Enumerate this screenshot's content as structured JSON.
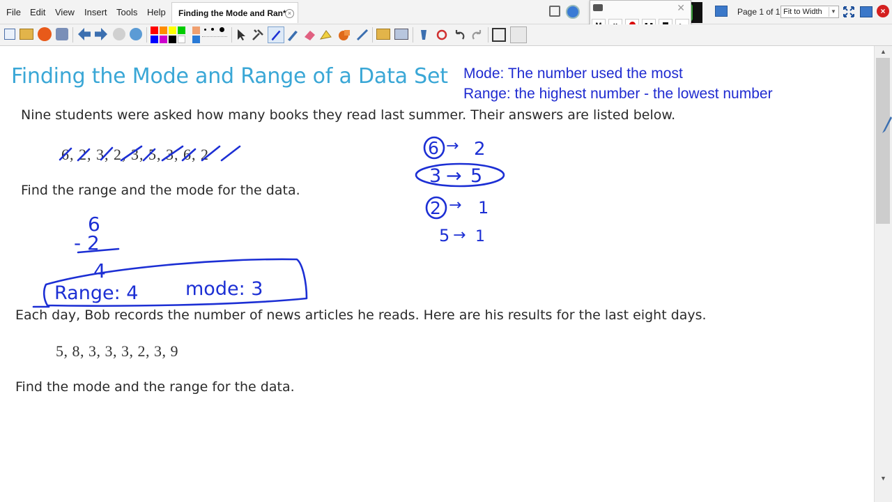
{
  "menu": {
    "items": [
      "File",
      "Edit",
      "View",
      "Insert",
      "Tools",
      "Help"
    ]
  },
  "tab": {
    "title": "Finding the Mode and Ran*",
    "close_glyph": "×"
  },
  "recorder": {
    "m_label": "M",
    "x_label": "×",
    "close_glyph": "✕"
  },
  "page_indicator": "Page 1 of 1",
  "zoom": {
    "selected": "Fit to Width"
  },
  "colors": {
    "accent_title": "#3aa7d6",
    "definition_text": "#1f2bd0",
    "ink": "#1c2fd4",
    "record_red": "#d80000",
    "palette": [
      "#ff0000",
      "#ff8c00",
      "#ffff00",
      "#00cc00",
      "#0000ff",
      "#cc00cc",
      "#000000",
      "#ffffff"
    ]
  },
  "icons": [
    "undo-icon",
    "redo-icon",
    "pen-icon",
    "highlighter-icon",
    "eraser-icon",
    "select-arrow-icon",
    "shape-icon",
    "fullscreen-icon",
    "close-window-icon"
  ],
  "document": {
    "title": "Finding the Mode and Range of a Data Set",
    "definitions": {
      "mode": "Mode: The number used the most",
      "range": "Range: the highest number - the lowest number"
    },
    "problem1": {
      "prompt": "Nine students were asked how many books they read last summer. Their answers are listed below.",
      "data": "6, 2, 3, 2, 3, 5, 3, 6, 2",
      "question": "Find the range and the mode for the data."
    },
    "problem2": {
      "prompt": "Each day, Bob records the number of news articles he reads. Here are his results for the last eight days.",
      "data": "5, 8, 3, 3, 3, 2, 3, 9",
      "question": "Find the mode and the range for the data."
    }
  },
  "annotations": {
    "sub_top": "6",
    "sub_bottom": "- 2",
    "sub_result": "4",
    "answer_range": "Range: 4",
    "answer_mode": "mode: 3",
    "tally": [
      {
        "value": "6",
        "arrow": "→",
        "count": "2"
      },
      {
        "value": "3",
        "arrow": "→",
        "count": "5"
      },
      {
        "value": "2",
        "arrow": "→",
        "count": "1"
      },
      {
        "value": "5",
        "arrow": "→",
        "count": "1"
      }
    ]
  }
}
